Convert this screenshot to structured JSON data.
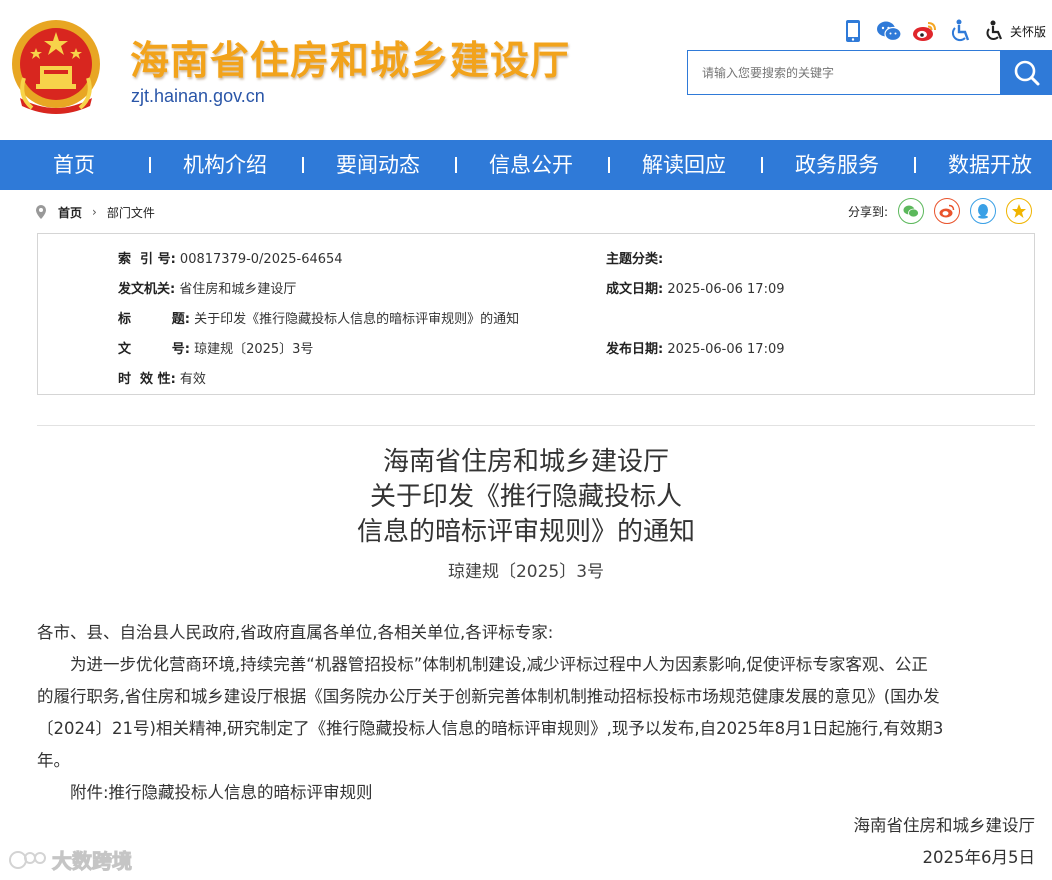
{
  "header": {
    "site_title": "海南省住房和城乡建设厅",
    "site_domain": "zjt.hainan.gov.cn",
    "care_mode_label": "关怀版",
    "icons": [
      "mobile-icon",
      "wechat-icon",
      "weibo-icon",
      "accessibility-icon",
      "care-mode-icon"
    ],
    "search_placeholder": "请输入您要搜索的关键字",
    "accent_color": "#2f7ad8",
    "title_color": "#f2a31b"
  },
  "nav": {
    "items": [
      "首页",
      "机构介绍",
      "要闻动态",
      "信息公开",
      "解读回应",
      "政务服务",
      "数据开放"
    ]
  },
  "breadcrumb": {
    "home": "首页",
    "current": "部门文件"
  },
  "share": {
    "label": "分享到:",
    "targets": [
      "wechat-share-icon",
      "weibo-share-icon",
      "qq-share-icon",
      "qzone-share-icon"
    ]
  },
  "info": {
    "index_label": "索  引 号:",
    "index_value": "00817379-0/2025-64654",
    "topic_label": "主题分类:",
    "topic_value": "",
    "issuer_label": "发文机关:",
    "issuer_value": "省住房和城乡建设厅",
    "created_label": "成文日期:",
    "created_value": "2025-06-06 17:09",
    "title_label": "标         题:",
    "title_value": "关于印发《推行隐藏投标人信息的暗标评审规则》的通知",
    "docno_label": "文         号:",
    "docno_value": "琼建规〔2025〕3号",
    "published_label": "发布日期:",
    "published_value": "2025-06-06 17:09",
    "validity_label": "时  效 性:",
    "validity_value": "有效"
  },
  "article": {
    "title_line1": "海南省住房和城乡建设厅",
    "title_line2": "关于印发《推行隐藏投标人",
    "title_line3": "信息的暗标评审规则》的通知",
    "doc_number": "琼建规〔2025〕3号",
    "salutation": "各市、县、自治县人民政府,省政府直属各单位,各相关单位,各评标专家:",
    "body_lines": [
      "为进一步优化营商环境,持续完善“机器管招投标”体制机制建设,减少评标过程中人为因素影响,促使评标专家客观、公正",
      "的履行职务,省住房和城乡建设厅根据《国务院办公厅关于创新完善体制机制推动招标投标市场规范健康发展的意见》(国办发",
      "〔2024〕21号)相关精神,研究制定了《推行隐藏投标人信息的暗标评审规则》,现予以发布,自2025年8月1日起施行,有效期3",
      "年。"
    ],
    "attachment": "附件:推行隐藏投标人信息的暗标评审规则",
    "signature_org": "海南省住房和城乡建设厅",
    "signature_date": "2025年6月5日"
  },
  "watermark": {
    "text": "大数跨境"
  }
}
